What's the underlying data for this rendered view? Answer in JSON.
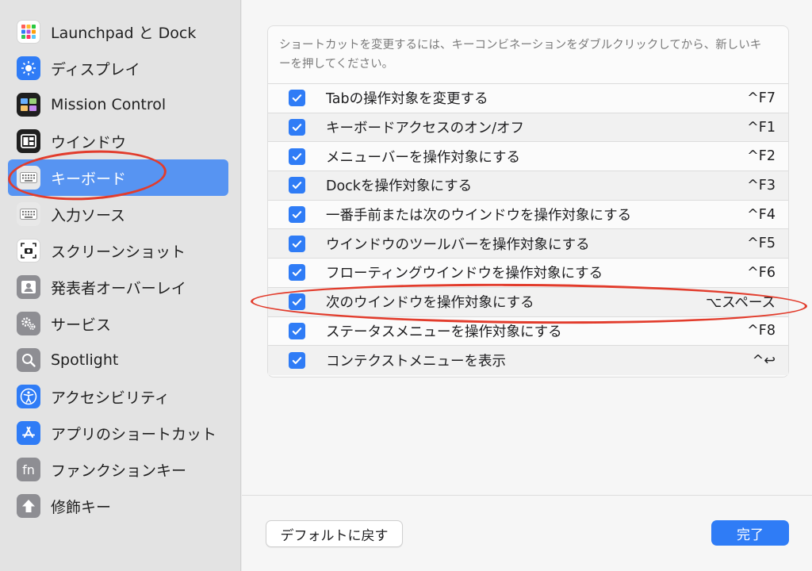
{
  "sidebar": {
    "items": [
      {
        "label": "Launchpad と Dock",
        "icon": "launchpad-grid-icon",
        "color": "#ffffff"
      },
      {
        "label": "ディスプレイ",
        "icon": "sun-icon",
        "color": "#2f7cf6"
      },
      {
        "label": "Mission Control",
        "icon": "mission-control-icon",
        "color": "#1f1f1f"
      },
      {
        "label": "ウインドウ",
        "icon": "window-icon",
        "color": "#1f1f1f"
      },
      {
        "label": "キーボード",
        "icon": "keyboard-icon",
        "color": "#bfbfbf"
      },
      {
        "label": "入力ソース",
        "icon": "keyboard-input-icon",
        "color": "#bfbfbf"
      },
      {
        "label": "スクリーンショット",
        "icon": "screenshot-icon",
        "color": "#ffffff"
      },
      {
        "label": "発表者オーバーレイ",
        "icon": "presenter-icon",
        "color": "#8e8e93"
      },
      {
        "label": "サービス",
        "icon": "gears-icon",
        "color": "#8e8e93"
      },
      {
        "label": "Spotlight",
        "icon": "magnifier-icon",
        "color": "#8e8e93"
      },
      {
        "label": "アクセシビリティ",
        "icon": "accessibility-icon",
        "color": "#2f7cf6"
      },
      {
        "label": "アプリのショートカット",
        "icon": "app-store-icon",
        "color": "#2f7cf6"
      },
      {
        "label": "ファンクションキー",
        "icon": "fn-icon",
        "color": "#8e8e93"
      },
      {
        "label": "修飾キー",
        "icon": "up-arrow-icon",
        "color": "#8e8e93"
      }
    ],
    "selected": "キーボード"
  },
  "panel": {
    "hint": "ショートカットを変更するには、キーコンビネーションをダブルクリックしてから、新しいキーを押してください。",
    "rows": [
      {
        "name": "Tabの操作対象を変更する",
        "key": "^F7",
        "checked": true
      },
      {
        "name": "キーボードアクセスのオン/オフ",
        "key": "^F1",
        "checked": true
      },
      {
        "name": "メニューバーを操作対象にする",
        "key": "^F2",
        "checked": true
      },
      {
        "name": "Dockを操作対象にする",
        "key": "^F3",
        "checked": true
      },
      {
        "name": "一番手前または次のウインドウを操作対象にする",
        "key": "^F4",
        "checked": true
      },
      {
        "name": "ウインドウのツールバーを操作対象にする",
        "key": "^F5",
        "checked": true
      },
      {
        "name": "フローティングウインドウを操作対象にする",
        "key": "^F6",
        "checked": true
      },
      {
        "name": "次のウインドウを操作対象にする",
        "key": "⌥スペース",
        "checked": true
      },
      {
        "name": "ステータスメニューを操作対象にする",
        "key": "^F8",
        "checked": true
      },
      {
        "name": "コンテクストメニューを表示",
        "key": "^↩",
        "checked": true
      }
    ]
  },
  "buttons": {
    "default_label": "デフォルトに戻す",
    "done_label": "完了"
  },
  "colors": {
    "accent": "#2f7cf6",
    "selection": "#5794f2",
    "annotation": "#e23c2c"
  }
}
